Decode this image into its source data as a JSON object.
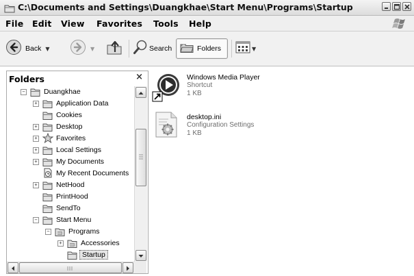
{
  "window": {
    "title": "C:\\Documents and Settings\\Duangkhae\\Start Menu\\Programs\\Startup"
  },
  "menubar": {
    "items": [
      "File",
      "Edit",
      "View",
      "Favorites",
      "Tools",
      "Help"
    ]
  },
  "toolbar": {
    "back_label": "Back",
    "search_label": "Search",
    "folders_label": "Folders"
  },
  "folders_pane": {
    "title": "Folders",
    "tree": [
      {
        "label": "Duangkhae",
        "expander": "−",
        "icon": "folder-open-icon"
      },
      {
        "label": "Application Data",
        "expander": "+",
        "icon": "folder-icon"
      },
      {
        "label": "Cookies",
        "expander": "",
        "icon": "folder-icon"
      },
      {
        "label": "Desktop",
        "expander": "+",
        "icon": "folder-icon"
      },
      {
        "label": "Favorites",
        "expander": "+",
        "icon": "star-icon"
      },
      {
        "label": "Local Settings",
        "expander": "+",
        "icon": "folder-icon"
      },
      {
        "label": "My Documents",
        "expander": "+",
        "icon": "folder-icon"
      },
      {
        "label": "My Recent Documents",
        "expander": "",
        "icon": "recent-docs-icon"
      },
      {
        "label": "NetHood",
        "expander": "+",
        "icon": "folder-icon"
      },
      {
        "label": "PrintHood",
        "expander": "",
        "icon": "folder-icon"
      },
      {
        "label": "SendTo",
        "expander": "",
        "icon": "folder-icon"
      },
      {
        "label": "Start Menu",
        "expander": "−",
        "icon": "folder-open-icon"
      },
      {
        "label": "Programs",
        "expander": "−",
        "icon": "programs-folder-icon"
      },
      {
        "label": "Accessories",
        "expander": "+",
        "icon": "programs-folder-icon"
      },
      {
        "label": "Startup",
        "expander": "",
        "icon": "folder-open-icon",
        "selected": true
      }
    ]
  },
  "files": [
    {
      "name": "Windows Media Player",
      "type": "Shortcut",
      "size": "1 KB",
      "icon": "media-player-icon"
    },
    {
      "name": "desktop.ini",
      "type": "Configuration Settings",
      "size": "1 KB",
      "icon": "config-file-icon"
    }
  ]
}
